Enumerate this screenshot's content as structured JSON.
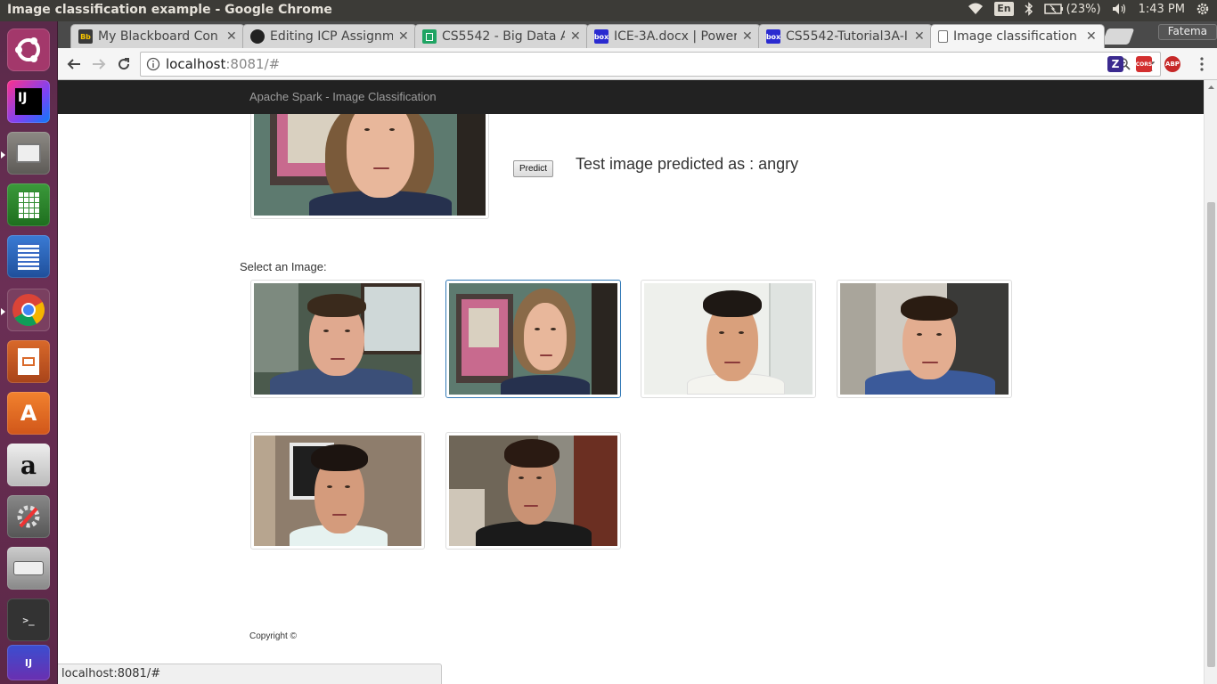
{
  "os": {
    "window_title": "Image classification example - Google Chrome",
    "language": "En",
    "battery": "(23%)",
    "clock": "1:43 PM"
  },
  "browser": {
    "tabs": [
      {
        "title": "My Blackboard Con",
        "favicon": "blackboard-icon",
        "favicon_text": "Bb",
        "color": "#3a3a3a"
      },
      {
        "title": "Editing ICP Assignm",
        "favicon": "github-icon",
        "favicon_text": "",
        "color": "#222222"
      },
      {
        "title": "CS5542 - Big Data A",
        "favicon": "sheets-icon",
        "favicon_text": "",
        "color": "#1fa463"
      },
      {
        "title": "ICE-3A.docx | Power",
        "favicon": "box-icon",
        "favicon_text": "box",
        "color": "#2a2ad0"
      },
      {
        "title": "CS5542-Tutorial3A-I",
        "favicon": "box-icon",
        "favicon_text": "box",
        "color": "#2a2ad0"
      },
      {
        "title": "Image classification",
        "favicon": "page-icon",
        "favicon_text": "",
        "color": "#ffffff"
      }
    ],
    "profile_name": "Fatema",
    "url_host": "localhost",
    "url_rest": ":8081/#",
    "status_url": "localhost:8081/#"
  },
  "page": {
    "brand": "Apache Spark - Image Classification",
    "predict_label": "Predict",
    "result_text": "Test image predicted as : angry",
    "select_label": "Select an Image:",
    "copyright": "Copyright ©",
    "selected_index": 1
  }
}
